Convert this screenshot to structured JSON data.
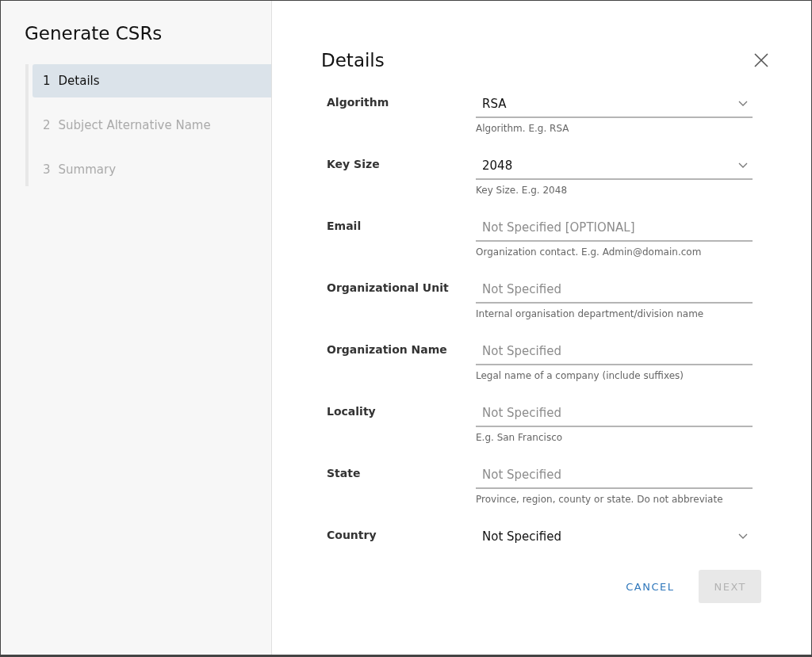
{
  "sidebar": {
    "title": "Generate CSRs",
    "steps": [
      {
        "number": "1",
        "label": "Details",
        "selected": true
      },
      {
        "number": "2",
        "label": "Subject Alternative Name",
        "selected": false
      },
      {
        "number": "3",
        "label": "Summary",
        "selected": false
      }
    ]
  },
  "content": {
    "title": "Details",
    "fields": [
      {
        "kind": "select",
        "label": "Algorithm",
        "value": "RSA",
        "hint": "Algorithm. E.g. RSA"
      },
      {
        "kind": "select",
        "label": "Key Size",
        "value": "2048",
        "hint": "Key Size. E.g. 2048"
      },
      {
        "kind": "input",
        "label": "Email",
        "placeholder": "Not Specified [OPTIONAL]",
        "hint": "Organization contact. E.g. Admin@domain.com"
      },
      {
        "kind": "input",
        "label": "Organizational Unit",
        "placeholder": "Not Specified",
        "hint": "Internal organisation department/division name"
      },
      {
        "kind": "input",
        "label": "Organization Name",
        "placeholder": "Not Specified",
        "hint": "Legal name of a company (include suffixes)"
      },
      {
        "kind": "input",
        "label": "Locality",
        "placeholder": "Not Specified",
        "hint": "E.g. San Francisco"
      },
      {
        "kind": "input",
        "label": "State",
        "placeholder": "Not Specified",
        "hint": "Province, region, county or state. Do not abbreviate"
      },
      {
        "kind": "bare-select",
        "label": "Country",
        "value": "Not Specified"
      }
    ]
  },
  "buttons": {
    "cancel": {
      "label": "CANCEL",
      "disabled": false
    },
    "next": {
      "label": "NEXT",
      "disabled": true
    }
  }
}
